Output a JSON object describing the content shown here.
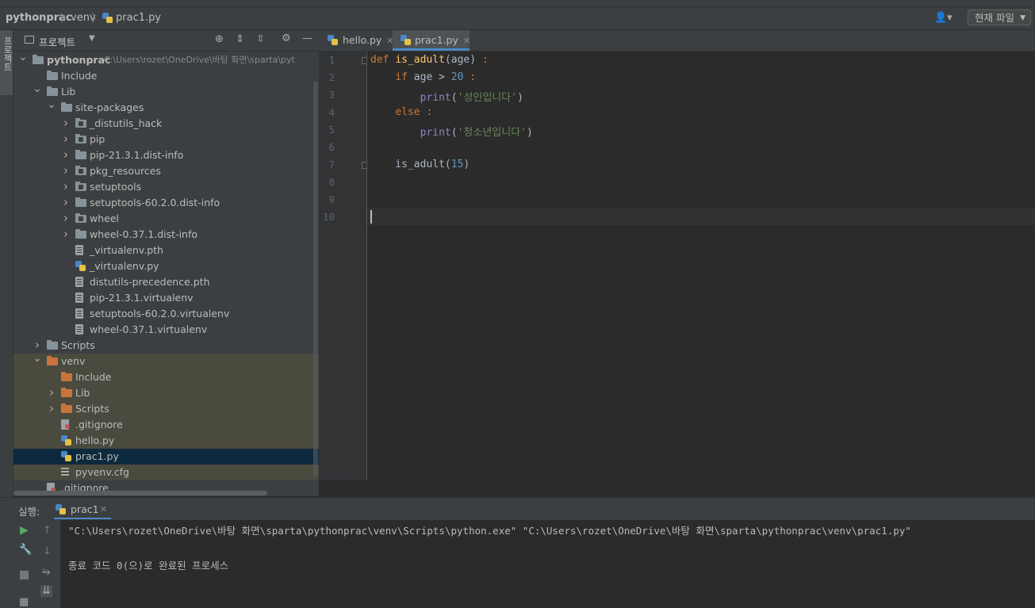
{
  "breadcrumb": [
    "pythonprac",
    "venv",
    "prac1.py"
  ],
  "run_config": "현재 파일",
  "left_strip_tab": "프로젝트",
  "project_panel": {
    "title": "프로젝트",
    "root_path": "C:\\Users\\rozet\\OneDrive\\바탕 화면\\sparta\\pyt"
  },
  "tree": [
    {
      "label": "pythonprac",
      "depth": 0,
      "arrow": "v",
      "icon": "folder-grey",
      "bold": true
    },
    {
      "label": "Include",
      "depth": 1,
      "arrow": "",
      "icon": "folder-grey"
    },
    {
      "label": "Lib",
      "depth": 1,
      "arrow": "v",
      "icon": "folder-grey"
    },
    {
      "label": "site-packages",
      "depth": 2,
      "arrow": "v",
      "icon": "folder-grey"
    },
    {
      "label": "_distutils_hack",
      "depth": 3,
      "arrow": ">",
      "icon": "package"
    },
    {
      "label": "pip",
      "depth": 3,
      "arrow": ">",
      "icon": "package"
    },
    {
      "label": "pip-21.3.1.dist-info",
      "depth": 3,
      "arrow": ">",
      "icon": "folder-grey"
    },
    {
      "label": "pkg_resources",
      "depth": 3,
      "arrow": ">",
      "icon": "package"
    },
    {
      "label": "setuptools",
      "depth": 3,
      "arrow": ">",
      "icon": "package"
    },
    {
      "label": "setuptools-60.2.0.dist-info",
      "depth": 3,
      "arrow": ">",
      "icon": "folder-grey"
    },
    {
      "label": "wheel",
      "depth": 3,
      "arrow": ">",
      "icon": "package"
    },
    {
      "label": "wheel-0.37.1.dist-info",
      "depth": 3,
      "arrow": ">",
      "icon": "folder-grey"
    },
    {
      "label": "_virtualenv.pth",
      "depth": 3,
      "arrow": "",
      "icon": "file"
    },
    {
      "label": "_virtualenv.py",
      "depth": 3,
      "arrow": "",
      "icon": "python"
    },
    {
      "label": "distutils-precedence.pth",
      "depth": 3,
      "arrow": "",
      "icon": "file"
    },
    {
      "label": "pip-21.3.1.virtualenv",
      "depth": 3,
      "arrow": "",
      "icon": "file"
    },
    {
      "label": "setuptools-60.2.0.virtualenv",
      "depth": 3,
      "arrow": "",
      "icon": "file"
    },
    {
      "label": "wheel-0.37.1.virtualenv",
      "depth": 3,
      "arrow": "",
      "icon": "file"
    },
    {
      "label": "Scripts",
      "depth": 1,
      "arrow": ">",
      "icon": "folder-grey"
    },
    {
      "label": "venv",
      "depth": 1,
      "arrow": "v",
      "icon": "folder-orange",
      "venv": true
    },
    {
      "label": "Include",
      "depth": 2,
      "arrow": "",
      "icon": "folder-orange",
      "venv": true
    },
    {
      "label": "Lib",
      "depth": 2,
      "arrow": ">",
      "icon": "folder-orange",
      "venv": true
    },
    {
      "label": "Scripts",
      "depth": 2,
      "arrow": ">",
      "icon": "folder-orange",
      "venv": true
    },
    {
      "label": ".gitignore",
      "depth": 2,
      "arrow": "",
      "icon": "git",
      "venv": true
    },
    {
      "label": "hello.py",
      "depth": 2,
      "arrow": "",
      "icon": "python",
      "venv": true
    },
    {
      "label": "prac1.py",
      "depth": 2,
      "arrow": "",
      "icon": "python",
      "selected": true
    },
    {
      "label": "pyvenv.cfg",
      "depth": 2,
      "arrow": "",
      "icon": "config",
      "venv": true
    },
    {
      "label": ".gitignore",
      "depth": 1,
      "arrow": "",
      "icon": "git"
    }
  ],
  "editor_tabs": [
    {
      "label": "hello.py",
      "active": false
    },
    {
      "label": "prac1.py",
      "active": true
    }
  ],
  "code_lines": [
    "def is_adult(age) :",
    "    if age > 20 :",
    "        print('성인입니다')",
    "    else :",
    "        print('청소년입니다')",
    "",
    "    is_adult(15)",
    "",
    "",
    ""
  ],
  "line_numbers": [
    "1",
    "2",
    "3",
    "4",
    "5",
    "6",
    "7",
    "8",
    "9",
    "10"
  ],
  "run_panel": {
    "label": "실행:",
    "tab": "prac1",
    "console": [
      "\"C:\\Users\\rozet\\OneDrive\\바탕 화면\\sparta\\pythonprac\\venv\\Scripts\\python.exe\" \"C:\\Users\\rozet\\OneDrive\\바탕 화면\\sparta\\pythonprac\\venv\\prac1.py\"",
      "",
      "종료 코드 0(으)로 완료된 프로세스"
    ]
  },
  "colors": {
    "background": "#2b2b2b",
    "panel": "#3c3f41",
    "selection": "#0d293e",
    "keyword": "#cc7832",
    "function": "#ffc66d",
    "number": "#6897bb",
    "string": "#6a8759",
    "accent": "#4a88c7"
  }
}
